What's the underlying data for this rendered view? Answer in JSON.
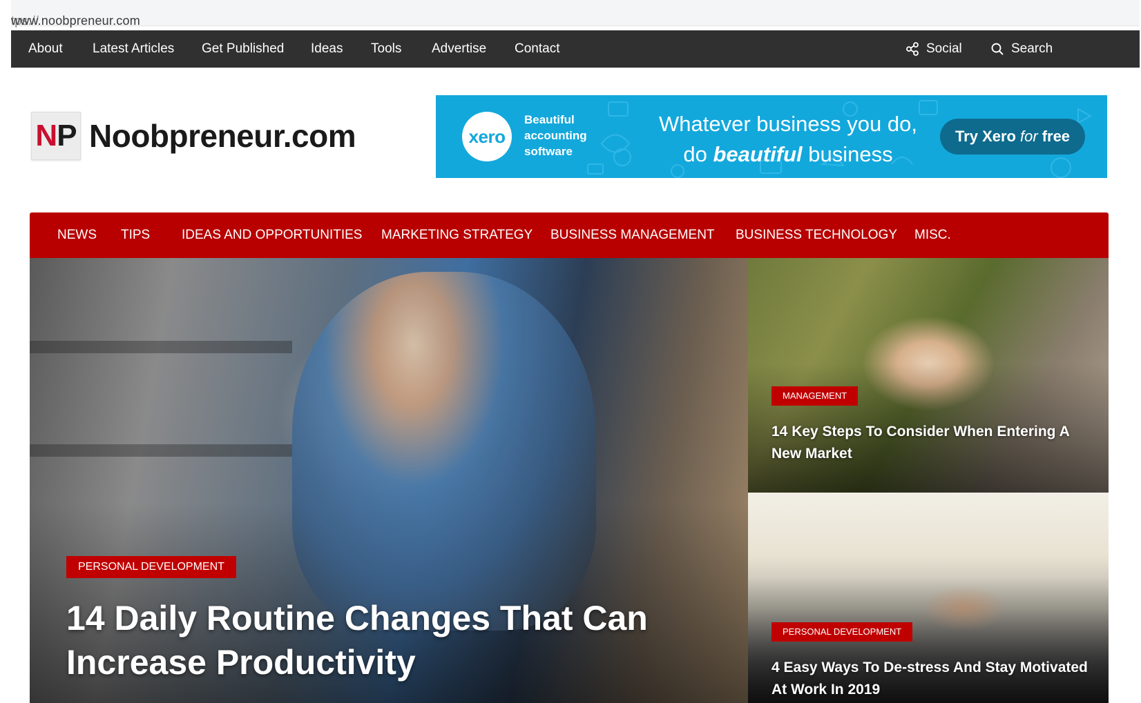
{
  "browser": {
    "url_prefix": "tps://",
    "url_rest": "www.noobpreneur.com"
  },
  "topnav": {
    "items": [
      "About",
      "Latest Articles",
      "Get Published",
      "Ideas",
      "Tools",
      "Advertise",
      "Contact"
    ],
    "social_label": "Social",
    "search_label": "Search",
    "icons": {
      "social": "share-icon",
      "search": "search-icon"
    }
  },
  "logo": {
    "np_n": "N",
    "np_p": "P",
    "name": "Noobpreneur.com"
  },
  "ad": {
    "brand": "xero",
    "tagline_1": "Beautiful",
    "tagline_2": "accounting",
    "tagline_3": "software",
    "headline_1": "Whatever business you do,",
    "headline_2_pre": "do",
    "headline_2_em": "beautiful",
    "headline_2_post": "business",
    "cta_pre": "Try Xero",
    "cta_em": "for",
    "cta_post": "free"
  },
  "catnav": {
    "items": [
      "NEWS",
      "TIPS",
      "IDEAS AND OPPORTUNITIES",
      "MARKETING STRATEGY",
      "BUSINESS MANAGEMENT",
      "BUSINESS TECHNOLOGY",
      "MISC."
    ]
  },
  "hero": {
    "category": "PERSONAL DEVELOPMENT",
    "title": "14 Daily Routine Changes That Can Increase Productivity"
  },
  "side": [
    {
      "category": "MANAGEMENT",
      "title": "14 Key Steps To Consider When Entering A New Market"
    },
    {
      "category": "PERSONAL DEVELOPMENT",
      "title": "4 Easy Ways To De-stress And Stay Motivated At Work In 2019"
    }
  ],
  "colors": {
    "topnav_bg": "#303030",
    "catnav_bg": "#b80000",
    "tag_bg": "#c00000",
    "ad_bg": "#13a8dc",
    "logo_accent": "#c8102e"
  }
}
